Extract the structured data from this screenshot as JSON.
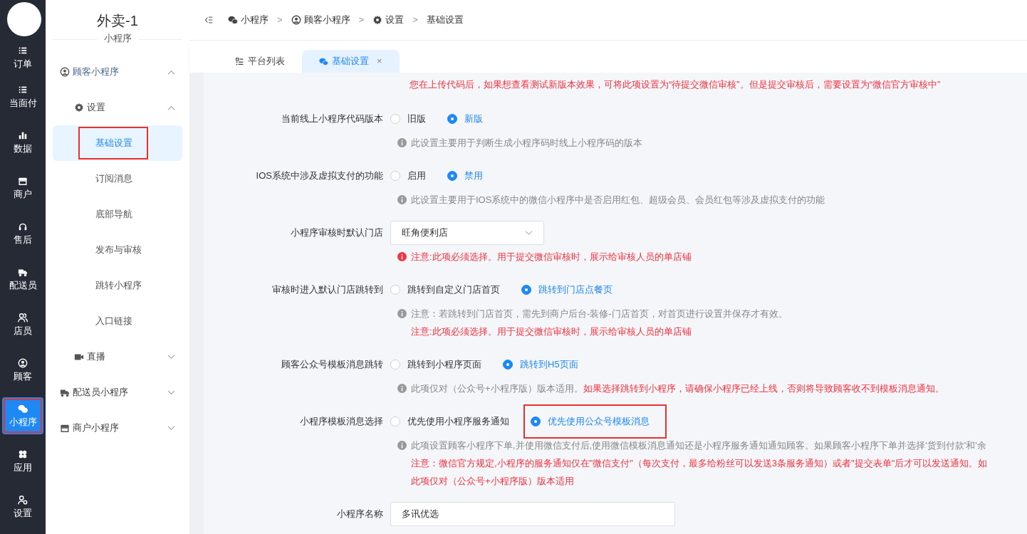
{
  "sidebar": {
    "items": [
      {
        "label": "订单",
        "selected": false,
        "highlighted": false
      },
      {
        "label": "当面付",
        "selected": false,
        "highlighted": false
      },
      {
        "label": "数据",
        "selected": false,
        "highlighted": false
      },
      {
        "label": "商户",
        "selected": false,
        "highlighted": false
      },
      {
        "label": "售后",
        "selected": false,
        "highlighted": false
      },
      {
        "label": "配送员",
        "selected": false,
        "highlighted": false
      },
      {
        "label": "店员",
        "selected": false,
        "highlighted": false
      },
      {
        "label": "顾客",
        "selected": false,
        "highlighted": false
      },
      {
        "label": "小程序",
        "selected": true,
        "highlighted": true
      },
      {
        "label": "应用",
        "selected": false,
        "highlighted": false
      },
      {
        "label": "设置",
        "selected": false,
        "highlighted": false
      }
    ]
  },
  "menu": {
    "title": "外卖-1",
    "subtitle": "小程序",
    "items": [
      {
        "label": "顾客小程序",
        "expanded": true,
        "children": [
          {
            "label": "设置",
            "expanded": true,
            "children": [
              {
                "label": "基础设置",
                "selected": true,
                "highlighted": true
              },
              {
                "label": "订阅消息",
                "selected": false,
                "highlighted": false
              },
              {
                "label": "底部导航",
                "selected": false,
                "highlighted": false
              },
              {
                "label": "发布与审核",
                "selected": false,
                "highlighted": false
              },
              {
                "label": "跳转小程序",
                "selected": false,
                "highlighted": false
              },
              {
                "label": "入口链接",
                "selected": false,
                "highlighted": false
              }
            ]
          },
          {
            "label": "直播",
            "expanded": false
          }
        ]
      },
      {
        "label": "配送员小程序",
        "expanded": false
      },
      {
        "label": "商户小程序",
        "expanded": false
      }
    ]
  },
  "breadcrumb": [
    {
      "label": "小程序"
    },
    {
      "separator": ">",
      "label": "顾客小程序"
    },
    {
      "separator": ">",
      "label": "设置"
    },
    {
      "separator": ">",
      "label": "基础设置"
    }
  ],
  "tabs": [
    {
      "label": "平台列表",
      "selected": false,
      "closable": false
    },
    {
      "label": "基础设置",
      "selected": true,
      "closable": true,
      "close": "×"
    }
  ],
  "top_notice": "您在上传代码后，如果想查看测试新版本效果，可将此项设置为“待提交微信审核”。但是提交审核后，需要设置为“微信官方审核中”",
  "form": [
    {
      "kind": "radio",
      "label": "当前线上小程序代码版本",
      "options": [
        {
          "label": "旧版",
          "selected": false,
          "highlighted": false
        },
        {
          "label": "新版",
          "selected": true,
          "highlighted": false
        }
      ],
      "notes": [
        {
          "kind": "info",
          "parts": [
            {
              "kind": "muted",
              "text": "此设置主要用于判断生成小程序码时线上小程序码的版本"
            }
          ]
        }
      ]
    },
    {
      "kind": "radio",
      "label": "IOS系统中涉及虚拟支付的功能",
      "options": [
        {
          "label": "启用",
          "selected": false,
          "highlighted": false
        },
        {
          "label": "禁用",
          "selected": true,
          "highlighted": false
        }
      ],
      "notes": [
        {
          "kind": "info",
          "parts": [
            {
              "kind": "muted",
              "text": "此设置主要用于IOS系统中的微信小程序中是否启用红包、超级会员、会员红包等涉及虚拟支付的功能"
            }
          ]
        }
      ]
    },
    {
      "kind": "select",
      "label": "小程序审核时默认门店",
      "value": "旺角便利店",
      "notes": [
        {
          "kind": "error",
          "parts": [
            {
              "kind": "danger",
              "text": "注意:此项必须选择。用于提交微信审核时，展示给审核人员的单店铺"
            }
          ]
        }
      ]
    },
    {
      "kind": "radio",
      "label": "审核时进入默认门店跳转到",
      "options": [
        {
          "label": "跳转到自定义门店首页",
          "selected": false,
          "highlighted": false
        },
        {
          "label": "跳转到门店点餐页",
          "selected": true,
          "highlighted": false
        }
      ],
      "notes": [
        {
          "kind": "info",
          "parts": [
            {
              "kind": "muted",
              "text": "注意：若跳转到门店首页，需先到商户后台-装修-门店首页，对首页进行设置并保存才有效。"
            }
          ]
        },
        {
          "kind": "plain",
          "parts": [
            {
              "kind": "danger",
              "text": "注意:此项必须选择。用于提交微信审核时，展示给审核人员的单店铺"
            }
          ]
        }
      ]
    },
    {
      "kind": "radio",
      "label": "顾客公众号模板消息跳转",
      "options": [
        {
          "label": "跳转到小程序页面",
          "selected": false,
          "highlighted": false
        },
        {
          "label": "跳转到H5页面",
          "selected": true,
          "highlighted": false
        }
      ],
      "notes": [
        {
          "kind": "info",
          "parts": [
            {
              "kind": "muted",
              "text": "此项仅对（公众号+小程序版）版本适用。"
            },
            {
              "kind": "danger",
              "text": "如果选择跳转到小程序，请确保小程序已经上线，否则将导致顾客收不到模板消息通知。"
            }
          ]
        }
      ]
    },
    {
      "kind": "radio",
      "label": "小程序模板消息选择",
      "options": [
        {
          "label": "优先使用小程序服务通知",
          "selected": false,
          "highlighted": false
        },
        {
          "label": "优先使用公众号模板消息",
          "selected": true,
          "highlighted": true
        }
      ],
      "notes": [
        {
          "kind": "info",
          "parts": [
            {
              "kind": "muted",
              "text": "此项设置顾客小程序下单,并使用微信支付后,使用微信模板消息通知还是小程序服务通知通知顾客。如果顾客小程序下单并选择'货到付款'和'余"
            }
          ]
        },
        {
          "kind": "plain",
          "parts": [
            {
              "kind": "danger",
              "text": "注意：微信官方规定,小程序的服务通知仅在\"微信支付\"（每次支付，最多给粉丝可以发送3条服务通知）或者\"提交表单\"后才可以发送通知。如"
            }
          ]
        },
        {
          "kind": "plain",
          "parts": [
            {
              "kind": "danger",
              "text": "此项仅对（公众号+小程序版）版本适用"
            }
          ]
        }
      ]
    },
    {
      "kind": "input",
      "label": "小程序名称",
      "value": "多讯优选"
    }
  ]
}
